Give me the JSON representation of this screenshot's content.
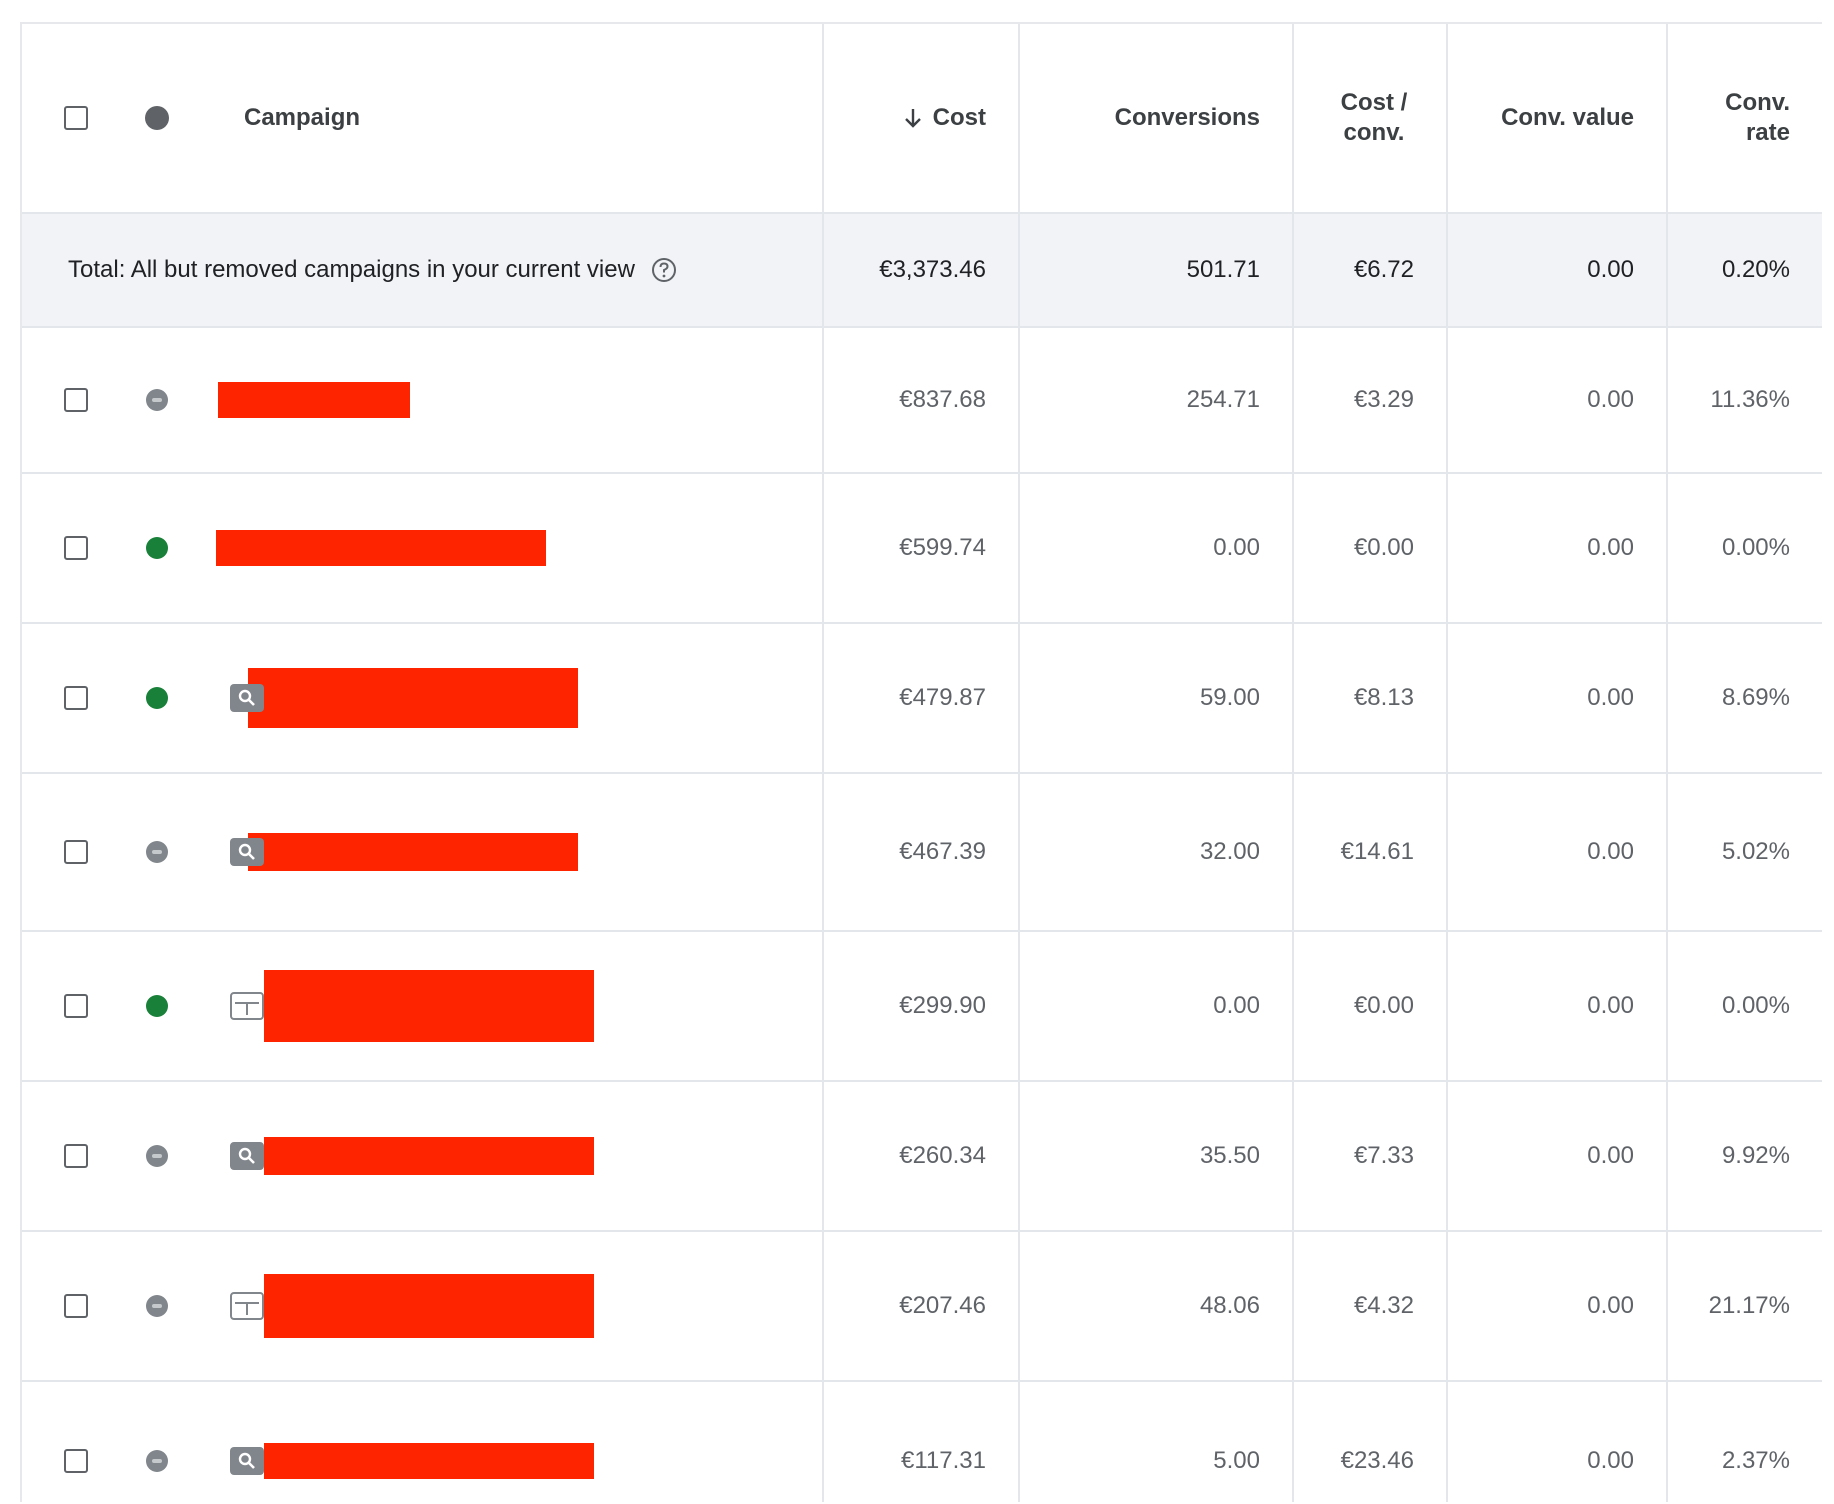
{
  "header": {
    "campaign": "Campaign",
    "cost": "Cost",
    "conversions": "Conversions",
    "cost_per_conv": "Cost / conv.",
    "conv_value": "Conv. value",
    "conv_rate": "Conv. rate"
  },
  "total": {
    "label": "Total: All but removed campaigns in your current view",
    "cost": "€3,373.46",
    "conversions": "501.71",
    "cost_per_conv": "€6.72",
    "conv_value": "0.00",
    "conv_rate": "0.20%"
  },
  "rows": [
    {
      "status": "paused",
      "type": "none",
      "cost": "€837.68",
      "conversions": "254.71",
      "cost_per_conv": "€3.29",
      "conv_value": "0.00",
      "conv_rate": "11.36%"
    },
    {
      "status": "enabled",
      "type": "none",
      "cost": "€599.74",
      "conversions": "0.00",
      "cost_per_conv": "€0.00",
      "conv_value": "0.00",
      "conv_rate": "0.00%"
    },
    {
      "status": "enabled",
      "type": "search",
      "cost": "€479.87",
      "conversions": "59.00",
      "cost_per_conv": "€8.13",
      "conv_value": "0.00",
      "conv_rate": "8.69%"
    },
    {
      "status": "paused",
      "type": "search",
      "cost": "€467.39",
      "conversions": "32.00",
      "cost_per_conv": "€14.61",
      "conv_value": "0.00",
      "conv_rate": "5.02%"
    },
    {
      "status": "enabled",
      "type": "display",
      "cost": "€299.90",
      "conversions": "0.00",
      "cost_per_conv": "€0.00",
      "conv_value": "0.00",
      "conv_rate": "0.00%"
    },
    {
      "status": "paused",
      "type": "search",
      "cost": "€260.34",
      "conversions": "35.50",
      "cost_per_conv": "€7.33",
      "conv_value": "0.00",
      "conv_rate": "9.92%"
    },
    {
      "status": "paused",
      "type": "display",
      "cost": "€207.46",
      "conversions": "48.06",
      "cost_per_conv": "€4.32",
      "conv_value": "0.00",
      "conv_rate": "21.17%"
    },
    {
      "status": "paused",
      "type": "search",
      "cost": "€117.31",
      "conversions": "5.00",
      "cost_per_conv": "€23.46",
      "conv_value": "0.00",
      "conv_rate": "2.37%"
    }
  ],
  "colors": {
    "enabled": "#188038",
    "paused": "#80868b",
    "redaction": "#ff2400"
  }
}
